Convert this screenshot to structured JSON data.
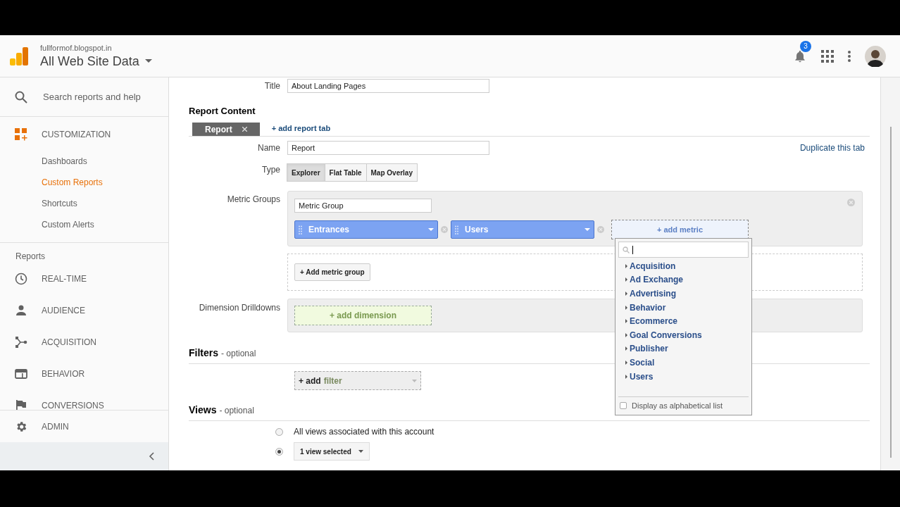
{
  "header": {
    "site": "fullformof.blogspot.in",
    "property": "All Web Site Data",
    "notifications": "3"
  },
  "sidebar": {
    "search_placeholder": "Search reports and help",
    "section": "CUSTOMIZATION",
    "items": [
      {
        "label": "Dashboards",
        "selected": false
      },
      {
        "label": "Custom Reports",
        "selected": true
      },
      {
        "label": "Shortcuts",
        "selected": false
      },
      {
        "label": "Custom Alerts",
        "selected": false
      }
    ],
    "reports_heading": "Reports",
    "reports": [
      {
        "label": "REAL-TIME",
        "kind": "clock"
      },
      {
        "label": "AUDIENCE",
        "kind": "person"
      },
      {
        "label": "ACQUISITION",
        "kind": "fork"
      },
      {
        "label": "BEHAVIOR",
        "kind": "window"
      },
      {
        "label": "CONVERSIONS",
        "kind": "flag"
      }
    ],
    "admin": "ADMIN"
  },
  "form": {
    "title": {
      "label": "Title",
      "value": "About Landing Pages"
    },
    "report_content": "Report Content",
    "tabs": [
      {
        "label": "Report",
        "selected": true
      }
    ],
    "add_tab": "+ add report tab",
    "duplicate": "Duplicate this tab",
    "name": {
      "label": "Name",
      "value": "Report"
    },
    "type": {
      "label": "Type",
      "options": [
        {
          "label": "Explorer",
          "selected": true
        },
        {
          "label": "Flat Table",
          "selected": false
        },
        {
          "label": "Map Overlay",
          "selected": false
        }
      ]
    },
    "metric_groups": {
      "label": "Metric Groups",
      "group_name": "Metric Group",
      "metrics": [
        "Entrances",
        "Users"
      ],
      "add_metric": "+ add metric",
      "add_group": "+ Add metric group"
    },
    "dimensions": {
      "label": "Dimension Drilldowns",
      "add": "+ add dimension"
    },
    "filters": {
      "heading": "Filters",
      "note": "- optional",
      "add": "+ add",
      "add_word": "filter"
    },
    "views": {
      "heading": "Views",
      "note": "- optional",
      "options": [
        {
          "kind": "text",
          "label": "All views associated with this account",
          "selected": false
        },
        {
          "kind": "select",
          "label": "1 view selected",
          "selected": true
        }
      ]
    }
  },
  "metric_menu": {
    "categories": [
      "Acquisition",
      "Ad Exchange",
      "Advertising",
      "Behavior",
      "Ecommerce",
      "Goal Conversions",
      "Publisher",
      "Social",
      "Users"
    ],
    "alphabetical": {
      "label": "Display as alphabetical list",
      "checked": false
    }
  }
}
